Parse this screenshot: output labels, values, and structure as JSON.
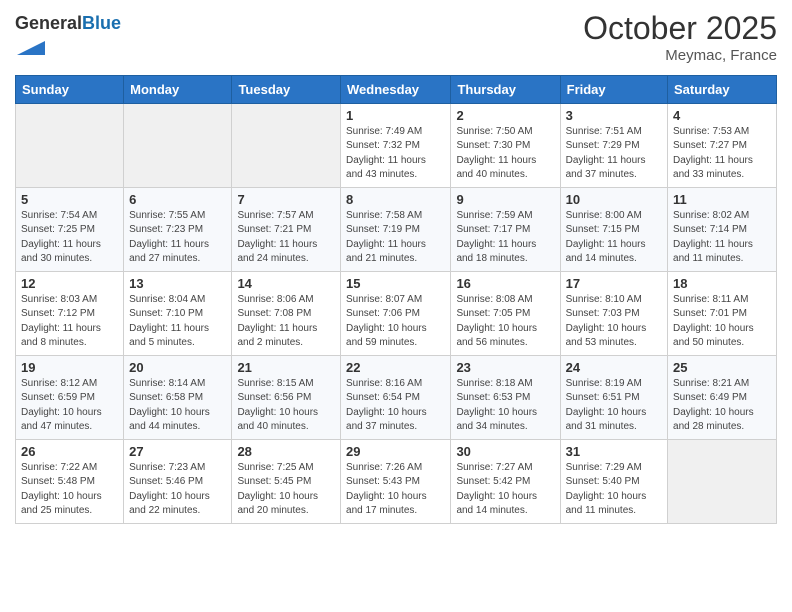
{
  "header": {
    "logo_general": "General",
    "logo_blue": "Blue",
    "month": "October 2025",
    "location": "Meymac, France"
  },
  "days_of_week": [
    "Sunday",
    "Monday",
    "Tuesday",
    "Wednesday",
    "Thursday",
    "Friday",
    "Saturday"
  ],
  "weeks": [
    [
      {
        "day": "",
        "info": ""
      },
      {
        "day": "",
        "info": ""
      },
      {
        "day": "",
        "info": ""
      },
      {
        "day": "1",
        "info": "Sunrise: 7:49 AM\nSunset: 7:32 PM\nDaylight: 11 hours\nand 43 minutes."
      },
      {
        "day": "2",
        "info": "Sunrise: 7:50 AM\nSunset: 7:30 PM\nDaylight: 11 hours\nand 40 minutes."
      },
      {
        "day": "3",
        "info": "Sunrise: 7:51 AM\nSunset: 7:29 PM\nDaylight: 11 hours\nand 37 minutes."
      },
      {
        "day": "4",
        "info": "Sunrise: 7:53 AM\nSunset: 7:27 PM\nDaylight: 11 hours\nand 33 minutes."
      }
    ],
    [
      {
        "day": "5",
        "info": "Sunrise: 7:54 AM\nSunset: 7:25 PM\nDaylight: 11 hours\nand 30 minutes."
      },
      {
        "day": "6",
        "info": "Sunrise: 7:55 AM\nSunset: 7:23 PM\nDaylight: 11 hours\nand 27 minutes."
      },
      {
        "day": "7",
        "info": "Sunrise: 7:57 AM\nSunset: 7:21 PM\nDaylight: 11 hours\nand 24 minutes."
      },
      {
        "day": "8",
        "info": "Sunrise: 7:58 AM\nSunset: 7:19 PM\nDaylight: 11 hours\nand 21 minutes."
      },
      {
        "day": "9",
        "info": "Sunrise: 7:59 AM\nSunset: 7:17 PM\nDaylight: 11 hours\nand 18 minutes."
      },
      {
        "day": "10",
        "info": "Sunrise: 8:00 AM\nSunset: 7:15 PM\nDaylight: 11 hours\nand 14 minutes."
      },
      {
        "day": "11",
        "info": "Sunrise: 8:02 AM\nSunset: 7:14 PM\nDaylight: 11 hours\nand 11 minutes."
      }
    ],
    [
      {
        "day": "12",
        "info": "Sunrise: 8:03 AM\nSunset: 7:12 PM\nDaylight: 11 hours\nand 8 minutes."
      },
      {
        "day": "13",
        "info": "Sunrise: 8:04 AM\nSunset: 7:10 PM\nDaylight: 11 hours\nand 5 minutes."
      },
      {
        "day": "14",
        "info": "Sunrise: 8:06 AM\nSunset: 7:08 PM\nDaylight: 11 hours\nand 2 minutes."
      },
      {
        "day": "15",
        "info": "Sunrise: 8:07 AM\nSunset: 7:06 PM\nDaylight: 10 hours\nand 59 minutes."
      },
      {
        "day": "16",
        "info": "Sunrise: 8:08 AM\nSunset: 7:05 PM\nDaylight: 10 hours\nand 56 minutes."
      },
      {
        "day": "17",
        "info": "Sunrise: 8:10 AM\nSunset: 7:03 PM\nDaylight: 10 hours\nand 53 minutes."
      },
      {
        "day": "18",
        "info": "Sunrise: 8:11 AM\nSunset: 7:01 PM\nDaylight: 10 hours\nand 50 minutes."
      }
    ],
    [
      {
        "day": "19",
        "info": "Sunrise: 8:12 AM\nSunset: 6:59 PM\nDaylight: 10 hours\nand 47 minutes."
      },
      {
        "day": "20",
        "info": "Sunrise: 8:14 AM\nSunset: 6:58 PM\nDaylight: 10 hours\nand 44 minutes."
      },
      {
        "day": "21",
        "info": "Sunrise: 8:15 AM\nSunset: 6:56 PM\nDaylight: 10 hours\nand 40 minutes."
      },
      {
        "day": "22",
        "info": "Sunrise: 8:16 AM\nSunset: 6:54 PM\nDaylight: 10 hours\nand 37 minutes."
      },
      {
        "day": "23",
        "info": "Sunrise: 8:18 AM\nSunset: 6:53 PM\nDaylight: 10 hours\nand 34 minutes."
      },
      {
        "day": "24",
        "info": "Sunrise: 8:19 AM\nSunset: 6:51 PM\nDaylight: 10 hours\nand 31 minutes."
      },
      {
        "day": "25",
        "info": "Sunrise: 8:21 AM\nSunset: 6:49 PM\nDaylight: 10 hours\nand 28 minutes."
      }
    ],
    [
      {
        "day": "26",
        "info": "Sunrise: 7:22 AM\nSunset: 5:48 PM\nDaylight: 10 hours\nand 25 minutes."
      },
      {
        "day": "27",
        "info": "Sunrise: 7:23 AM\nSunset: 5:46 PM\nDaylight: 10 hours\nand 22 minutes."
      },
      {
        "day": "28",
        "info": "Sunrise: 7:25 AM\nSunset: 5:45 PM\nDaylight: 10 hours\nand 20 minutes."
      },
      {
        "day": "29",
        "info": "Sunrise: 7:26 AM\nSunset: 5:43 PM\nDaylight: 10 hours\nand 17 minutes."
      },
      {
        "day": "30",
        "info": "Sunrise: 7:27 AM\nSunset: 5:42 PM\nDaylight: 10 hours\nand 14 minutes."
      },
      {
        "day": "31",
        "info": "Sunrise: 7:29 AM\nSunset: 5:40 PM\nDaylight: 10 hours\nand 11 minutes."
      },
      {
        "day": "",
        "info": ""
      }
    ]
  ]
}
